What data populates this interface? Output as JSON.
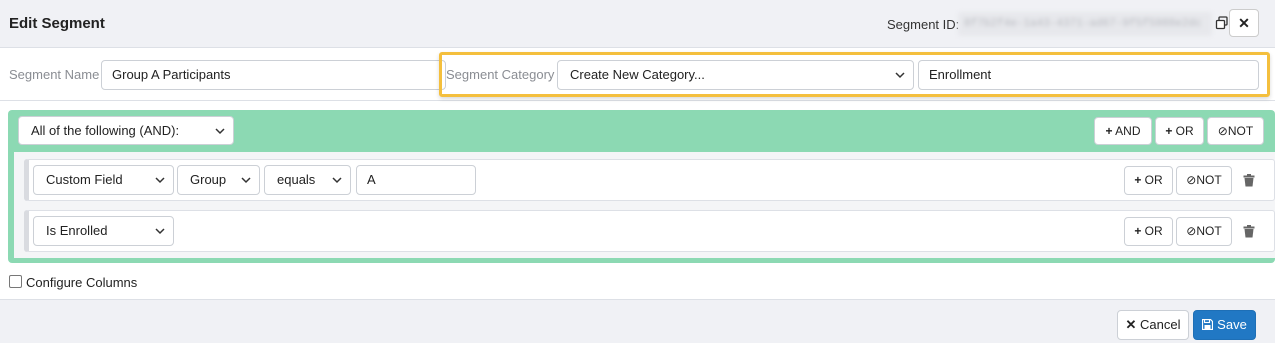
{
  "header": {
    "title": "Edit Segment",
    "segment_id_label": "Segment ID:",
    "segment_id_value": "8f7b2f4e-1a43-4371-ad67-9f5f5988e2dc",
    "copy_icon": "copy-icon",
    "close_icon": "close-icon",
    "close_glyph": "✕"
  },
  "form": {
    "segment_name_label": "Segment Name",
    "segment_name_value": "Group A Participants",
    "segment_category_label": "Segment Category",
    "segment_category_selected": "Create New Category...",
    "new_category_value": "Enrollment",
    "highlight_color": "#f4bf3d"
  },
  "builder": {
    "group_operator": "All of the following (AND):",
    "accent_color": "#8cd9b3",
    "add_and_label": "AND",
    "add_or_label": "OR",
    "not_label": "NOT",
    "rules": [
      {
        "field_type": "Custom Field",
        "field": "Group",
        "operator": "equals",
        "value": "A",
        "or_label": "OR",
        "not_label": "NOT"
      },
      {
        "field_type": "Is Enrolled",
        "or_label": "OR",
        "not_label": "NOT"
      }
    ]
  },
  "options": {
    "configure_columns_label": "Configure Columns"
  },
  "footer": {
    "cancel_label": "Cancel",
    "save_label": "Save",
    "save_color": "#2178c4"
  }
}
